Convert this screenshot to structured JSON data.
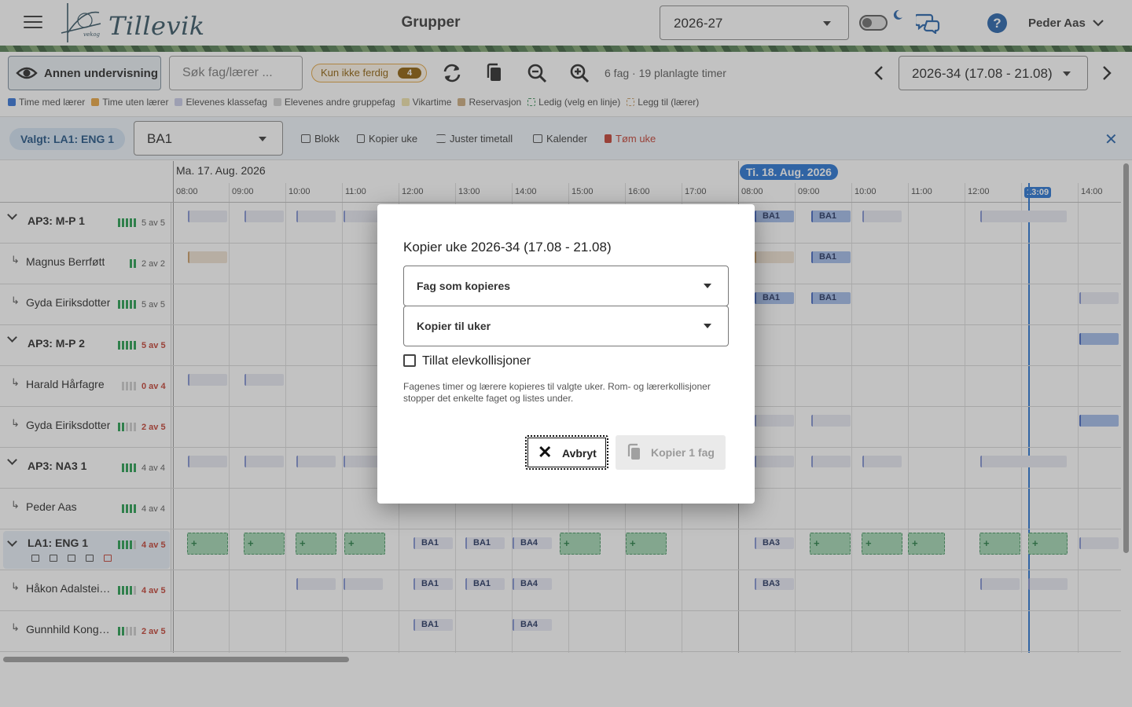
{
  "header": {
    "logo_text": "Tillevik",
    "logo_sub": "vekog",
    "title": "Grupper",
    "school_year": "2026-27",
    "user_name": "Peder Aas"
  },
  "toolbar": {
    "view_button": "Annen undervisning",
    "search_placeholder": "Søk fag/lærer ...",
    "filter_chip_label": "Kun ikke ferdig",
    "filter_chip_count": "4",
    "summary": "6 fag · 19 planlagte timer",
    "week_select": "2026-34 (17.08 - 21.08)"
  },
  "legend": [
    {
      "label": "Time med lærer",
      "color": "#2f6fd6"
    },
    {
      "label": "Time uten lærer",
      "color": "#e8a23a"
    },
    {
      "label": "Elevenes klassefag",
      "color": "#c7c9e6"
    },
    {
      "label": "Elevenes andre gruppefag",
      "color": "#cfcfcf"
    },
    {
      "label": "Vikartime",
      "color": "#efe0a6"
    },
    {
      "label": "Reservasjon",
      "color": "#c9a87a"
    },
    {
      "label": "Ledig (velg en linje)",
      "color": "#ffffff"
    },
    {
      "label": "Legg til (lærer)",
      "color": "#ffffff"
    }
  ],
  "selection": {
    "chip": "Valgt: LA1: ENG 1",
    "group_select": "BA1",
    "actions": [
      "Blokk",
      "Kopier uke",
      "Juster timetall",
      "Kalender",
      "Tøm uke"
    ]
  },
  "calendar": {
    "day1": "Ma. 17. Aug. 2026",
    "day2": "Ti. 18. Aug. 2026",
    "times_day1": [
      "08:00",
      "09:00",
      "10:00",
      "11:00",
      "12:00",
      "13:00",
      "14:00",
      "15:00",
      "16:00",
      "17:00"
    ],
    "times_day2": [
      "08:00",
      "09:00",
      "10:00",
      "11:00",
      "12:00",
      "13:09",
      "14:00"
    ],
    "rows": [
      {
        "name": "AP3: M-P 1",
        "type": "group",
        "count": "5 av 5",
        "done": 5,
        "total": 5,
        "bad": false
      },
      {
        "name": "Magnus Berrføtt",
        "type": "teacher",
        "count": "2 av 2",
        "done": 2,
        "total": 2,
        "bad": false
      },
      {
        "name": "Gyda Eiriksdotter",
        "type": "teacher",
        "count": "5 av 5",
        "done": 5,
        "total": 5,
        "bad": false
      },
      {
        "name": "AP3: M-P 2",
        "type": "group",
        "count": "5 av 5",
        "done": 5,
        "total": 5,
        "bad": true
      },
      {
        "name": "Harald Hårfagre",
        "type": "teacher",
        "count": "0 av 4",
        "done": 0,
        "total": 4,
        "bad": true
      },
      {
        "name": "Gyda Eiriksdotter",
        "type": "teacher",
        "count": "2 av 5",
        "done": 2,
        "total": 5,
        "bad": true
      },
      {
        "name": "AP3: NA3 1",
        "type": "group",
        "count": "4 av 4",
        "done": 4,
        "total": 4,
        "bad": false
      },
      {
        "name": "Peder Aas",
        "type": "teacher",
        "count": "4 av 4",
        "done": 4,
        "total": 4,
        "bad": false
      },
      {
        "name": "LA1: ENG 1",
        "type": "group",
        "count": "4 av 5",
        "done": 4,
        "total": 5,
        "bad": true
      },
      {
        "name": "Håkon Adalstei…",
        "type": "teacher",
        "count": "4 av 5",
        "done": 4,
        "total": 5,
        "bad": true
      },
      {
        "name": "Gunnhild Kong…",
        "type": "teacher",
        "count": "2 av 5",
        "done": 2,
        "total": 5,
        "bad": true
      }
    ],
    "slot_labels": [
      "BA1",
      "BA3",
      "BA4"
    ]
  },
  "dialog": {
    "title": "Kopier uke 2026-34 (17.08 - 21.08)",
    "select_subjects": "Fag som kopieres",
    "select_weeks": "Kopier til uker",
    "checkbox_label": "Tillat elevkollisjoner",
    "hint": "Fagenes timer og lærere kopieres til valgte uker. Rom- og lærerkollisjoner stopper det enkelte faget og listes under.",
    "cancel": "Avbryt",
    "confirm": "Kopier 1 fag"
  },
  "colors": {
    "accent": "#1f6fd1",
    "ok_green": "#1f9a4a",
    "bad_red": "#c0392b",
    "warn": "#e2a23b"
  }
}
